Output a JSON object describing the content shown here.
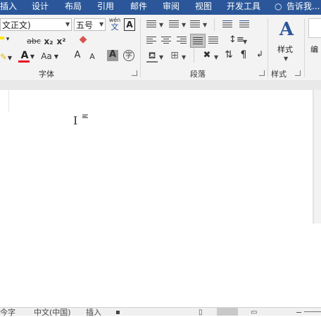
{
  "menu": {
    "tabs": [
      "插入",
      "设计",
      "布局",
      "引用",
      "邮件",
      "审阅",
      "视图",
      "开发工具"
    ],
    "tell_me": "告诉我..."
  },
  "font": {
    "name_value": "文正文)",
    "size_value": "五号",
    "phonetic_top": "wén",
    "phonetic_bottom": "文"
  },
  "groups": {
    "font": "字体",
    "paragraph": "段落",
    "styles": "样式",
    "styles_button": "样式",
    "editing_partial": "编"
  },
  "toolbar": {
    "strikethrough": "abc",
    "subscript": "x₂",
    "superscript": "x²",
    "color_a": "A",
    "case": "Aa",
    "grow": "A",
    "shrink": "A",
    "char_border": "字"
  },
  "status": {
    "left_partial": "今字",
    "language": "中文(中国)",
    "insert_mode": "插入"
  },
  "colors": {
    "ribbon_blue": "#2b579a",
    "font_color_red": "#e81123",
    "highlight_yellow": "#ffe600"
  }
}
